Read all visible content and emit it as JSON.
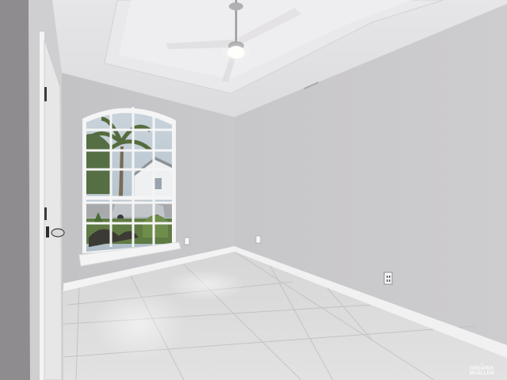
{
  "image": {
    "subject": "empty room",
    "watermark": "GREATER MCALLEN",
    "palette": {
      "wall_left": "#c4c3c6",
      "wall_right": "#c9c8cb",
      "ceiling": "#e4e3e5",
      "floor": "#dcdcdc",
      "baseboard": "#f2f2f2",
      "door": "#e9e9ea",
      "window_sky": "#b9c7d2",
      "foliage": "#4f6b3a"
    }
  }
}
